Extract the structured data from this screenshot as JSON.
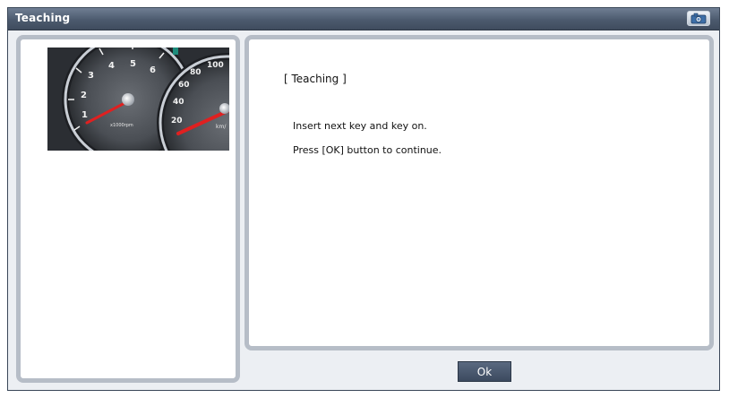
{
  "window": {
    "title": "Teaching",
    "camera_icon": "camera-icon"
  },
  "gauge_image": {
    "description_icon": "instrument-cluster-image",
    "tach_numbers": [
      "1",
      "2",
      "3",
      "4",
      "5",
      "6"
    ],
    "tach_unit": "x1000rpm",
    "speedo_numbers": [
      "20",
      "40",
      "60",
      "80",
      "100"
    ],
    "speedo_unit": "km/"
  },
  "message": {
    "heading": "[ Teaching ]",
    "line1": "Insert next key and key on.",
    "line2": "Press [OK] button to continue."
  },
  "buttons": {
    "ok_label": "Ok"
  },
  "colors": {
    "titlebar": "#4c5a6e",
    "panel_border": "#b6bdc7",
    "button": "#4a586d",
    "needle": "#d01818"
  }
}
